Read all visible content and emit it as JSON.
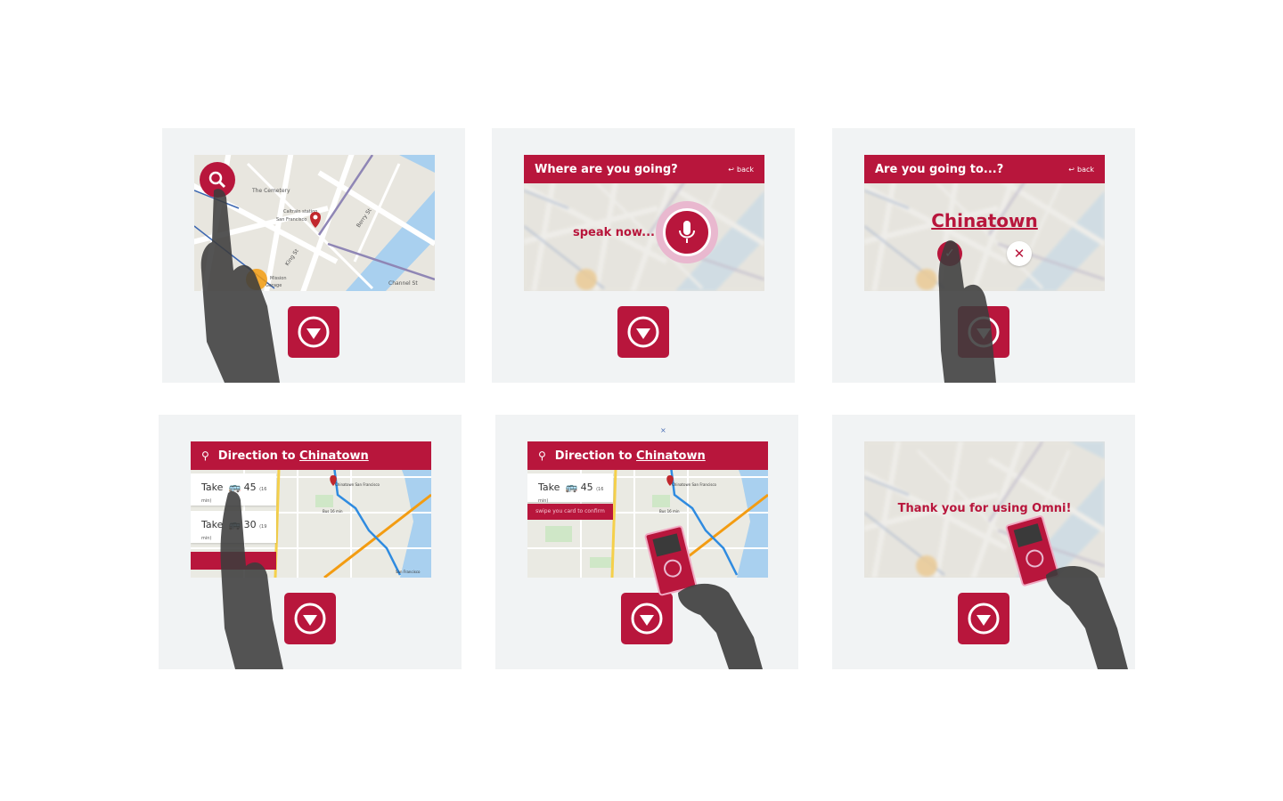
{
  "map_labels": {
    "cemetery": "The Cemetery",
    "caltrain": "Caltrain station",
    "sf": "San Francisco",
    "king": "King St",
    "berry": "Berry St",
    "channel": "Channel St",
    "mission": "Mission",
    "garage": "Garage"
  },
  "panel2": {
    "header_title": "Where are you going?",
    "back_label": "back",
    "speak_prompt": "speak now..."
  },
  "panel3": {
    "header_title": "Are you going to...?",
    "back_label": "back",
    "destination": "Chinatown",
    "confirm_symbol": "✓",
    "cancel_symbol": "✕"
  },
  "panel4": {
    "header_prefix": "Direction to",
    "header_dest": "Chinatown",
    "options": [
      {
        "take": "Take",
        "route": "45",
        "minutes": "(16 min)"
      },
      {
        "take": "Take",
        "route": "30",
        "minutes": "(19 min)"
      }
    ],
    "map_label_dest": "Chinatown San Francisco",
    "map_label_bus": "Bus 16 min",
    "map_label_sf": "San Francisco"
  },
  "panel5": {
    "close_symbol": "×",
    "header_prefix": "Direction to",
    "header_dest": "Chinatown",
    "option": {
      "take": "Take",
      "route": "45",
      "minutes": "(16 min)"
    },
    "confirm_text": "swipe you card to confirm",
    "map_label_dest": "Chinatown San Francisco",
    "map_label_bus": "Bus 16 min"
  },
  "panel6": {
    "thanks": "Thank you for using Omni!"
  },
  "colors": {
    "brand": "#b8163c",
    "panel_bg": "#f1f3f4",
    "hand": "#3c3c3c",
    "water": "#a9d0ef",
    "transit_orange": "#f39c12"
  },
  "icons": {
    "search": "search-icon",
    "mic": "microphone-icon",
    "back": "back-arrow-icon",
    "down": "down-triangle-icon",
    "bus": "bus-icon",
    "card": "transit-card-icon",
    "pin": "map-pin-icon"
  }
}
